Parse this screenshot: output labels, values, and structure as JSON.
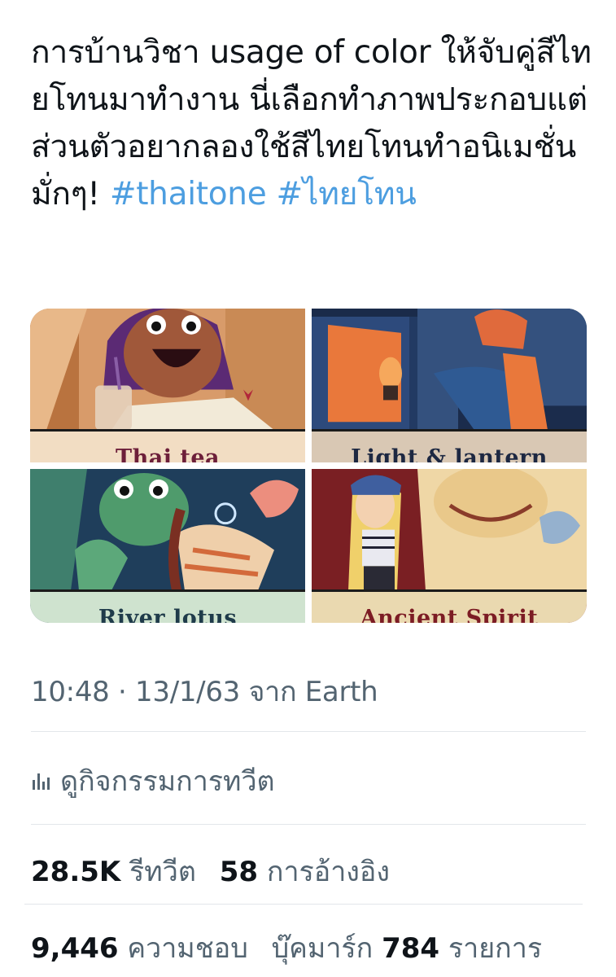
{
  "tweet": {
    "text_plain": "การบ้านวิชา usage of color ให้จับคู่สีไทยโทนมาทำงาน นี่เลือกทำภาพประกอบแต่ส่วนตัวอยากลองใช้สีไทยโทนทำอนิเมชั่นมั่กๆ! ",
    "hashtag_1": "#thaitone",
    "hashtag_2": "#ไทยโทน"
  },
  "media": [
    {
      "caption": "Thai tea",
      "caption_color": "#6d1f3a",
      "caption_bg": "#f2ddc3"
    },
    {
      "caption": "Light & lantern",
      "caption_color": "#1d2842",
      "caption_bg": "#d9c8b4"
    },
    {
      "caption": "River lotus",
      "caption_color": "#1f3b4a",
      "caption_bg": "#cfe3cf"
    },
    {
      "caption": "Ancient Spirit",
      "caption_color": "#7c1c24",
      "caption_bg": "#ead9b0"
    }
  ],
  "meta": {
    "time": "10:48",
    "separator": "·",
    "date": "13/1/63",
    "source_prefix": "จาก",
    "source": "Earth"
  },
  "activity": {
    "label": "ดูกิจกรรมการทวีต"
  },
  "stats": {
    "retweets_count": "28.5K",
    "retweets_label": "รีทวีต",
    "quotes_count": "58",
    "quotes_label": "การอ้างอิง",
    "likes_count": "9,446",
    "likes_label": "ความชอบ",
    "bookmarks_prefix": "บุ๊คมาร์ก",
    "bookmarks_count": "784",
    "bookmarks_label": "รายการ"
  },
  "colors": {
    "hashtag": "#4d9ee0",
    "secondary_text": "#536471",
    "primary_text": "#0f1419"
  }
}
